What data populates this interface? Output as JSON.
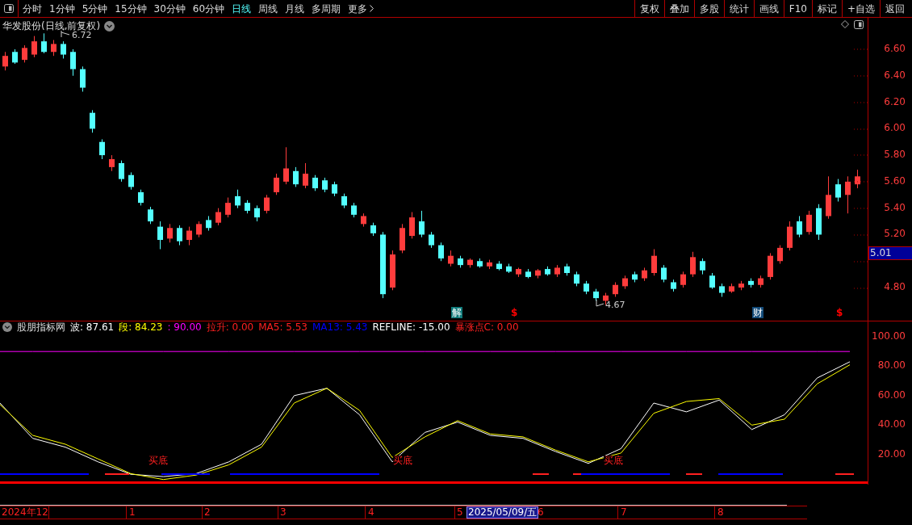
{
  "toolbar": {
    "periods": [
      {
        "label": "分时",
        "selected": false
      },
      {
        "label": "1分钟",
        "selected": false
      },
      {
        "label": "5分钟",
        "selected": false
      },
      {
        "label": "15分钟",
        "selected": false
      },
      {
        "label": "30分钟",
        "selected": false
      },
      {
        "label": "60分钟",
        "selected": false
      },
      {
        "label": "日线",
        "selected": true
      },
      {
        "label": "周线",
        "selected": false
      },
      {
        "label": "月线",
        "selected": false
      },
      {
        "label": "多周期",
        "selected": false
      }
    ],
    "more": "更多",
    "actions": [
      "复权",
      "叠加",
      "多股",
      "统计",
      "画线",
      "F10",
      "标记",
      "+自选",
      "返回"
    ]
  },
  "price_chart": {
    "title": "华发股份(日线,前复权)",
    "high_label": "6.72",
    "low_label": "4.67",
    "markers": [
      {
        "text": "解",
        "kind": "badge",
        "color": "#0f7a7a"
      },
      {
        "text": "$",
        "kind": "dollar",
        "color": "#ff0000"
      },
      {
        "text": "财",
        "kind": "badge",
        "color": "#124a78"
      },
      {
        "text": "$",
        "kind": "dollar",
        "color": "#ff0000"
      }
    ],
    "chart_data": {
      "type": "candlestick",
      "ylim": [
        4.55,
        6.838
      ],
      "yticks": [
        {
          "value": 6.6,
          "label": "6.60"
        },
        {
          "value": 6.4,
          "label": "6.40"
        },
        {
          "value": 6.2,
          "label": "6.20"
        },
        {
          "value": 6.0,
          "label": "6.00"
        },
        {
          "value": 5.8,
          "label": "5.80"
        },
        {
          "value": 5.6,
          "label": "5.60"
        },
        {
          "value": 5.4,
          "label": "5.40"
        },
        {
          "value": 5.2,
          "label": "5.20"
        },
        {
          "value": 4.8,
          "label": "4.80"
        }
      ],
      "categories": [
        null,
        null,
        null,
        null,
        null,
        null,
        null,
        null,
        null,
        null,
        null,
        null,
        null,
        null,
        null,
        null,
        null,
        null,
        null,
        null,
        null,
        null,
        null,
        null,
        null,
        null,
        null,
        null,
        null,
        null,
        null,
        null,
        null,
        null,
        null,
        null,
        null,
        null,
        null,
        null,
        null,
        null,
        null,
        null,
        null,
        null,
        null,
        null,
        null,
        null,
        null,
        null,
        null,
        null,
        null,
        null,
        null,
        null,
        null,
        null,
        null,
        null,
        null,
        null,
        null,
        null,
        null,
        null,
        null,
        null,
        null,
        null,
        null,
        null,
        null,
        null,
        null,
        null,
        null,
        null,
        null,
        null,
        null,
        null,
        null,
        null,
        null,
        null,
        null
      ],
      "ohlc": [
        [
          6.47,
          6.58,
          6.44,
          6.55
        ],
        [
          6.58,
          6.6,
          6.49,
          6.5
        ],
        [
          6.52,
          6.63,
          6.5,
          6.61
        ],
        [
          6.56,
          6.7,
          6.54,
          6.66
        ],
        [
          6.66,
          6.72,
          6.57,
          6.58
        ],
        [
          6.58,
          6.67,
          6.55,
          6.64
        ],
        [
          6.64,
          6.66,
          6.53,
          6.56
        ],
        [
          6.58,
          6.6,
          6.4,
          6.45
        ],
        [
          6.45,
          6.47,
          6.28,
          6.31
        ],
        [
          6.12,
          6.14,
          5.97,
          6.0
        ],
        [
          5.9,
          5.92,
          5.77,
          5.8
        ],
        [
          5.71,
          5.8,
          5.68,
          5.77
        ],
        [
          5.74,
          5.76,
          5.6,
          5.62
        ],
        [
          5.65,
          5.67,
          5.54,
          5.56
        ],
        [
          5.52,
          5.54,
          5.42,
          5.44
        ],
        [
          5.39,
          5.41,
          5.28,
          5.3
        ],
        [
          5.26,
          5.3,
          5.09,
          5.16
        ],
        [
          5.17,
          5.28,
          5.14,
          5.25
        ],
        [
          5.25,
          5.27,
          5.12,
          5.15
        ],
        [
          5.16,
          5.26,
          5.12,
          5.23
        ],
        [
          5.2,
          5.3,
          5.18,
          5.28
        ],
        [
          5.31,
          5.34,
          5.23,
          5.25
        ],
        [
          5.29,
          5.4,
          5.27,
          5.37
        ],
        [
          5.35,
          5.48,
          5.33,
          5.44
        ],
        [
          5.49,
          5.54,
          5.4,
          5.42
        ],
        [
          5.44,
          5.46,
          5.36,
          5.38
        ],
        [
          5.4,
          5.42,
          5.3,
          5.33
        ],
        [
          5.38,
          5.5,
          5.36,
          5.48
        ],
        [
          5.52,
          5.66,
          5.5,
          5.63
        ],
        [
          5.6,
          5.86,
          5.58,
          5.7
        ],
        [
          5.68,
          5.71,
          5.56,
          5.58
        ],
        [
          5.57,
          5.74,
          5.55,
          5.66
        ],
        [
          5.63,
          5.65,
          5.53,
          5.55
        ],
        [
          5.61,
          5.63,
          5.52,
          5.54
        ],
        [
          5.58,
          5.6,
          5.49,
          5.51
        ],
        [
          5.49,
          5.51,
          5.4,
          5.42
        ],
        [
          5.42,
          5.44,
          5.33,
          5.35
        ],
        [
          5.28,
          5.36,
          5.26,
          5.34
        ],
        [
          5.27,
          5.29,
          5.19,
          5.21
        ],
        [
          5.2,
          5.22,
          4.72,
          4.75
        ],
        [
          4.8,
          5.08,
          4.78,
          5.05
        ],
        [
          5.08,
          5.28,
          5.06,
          5.25
        ],
        [
          5.19,
          5.37,
          5.17,
          5.33
        ],
        [
          5.3,
          5.38,
          5.18,
          5.2
        ],
        [
          5.2,
          5.22,
          5.1,
          5.12
        ],
        [
          5.12,
          5.14,
          5.0,
          5.02
        ],
        [
          4.98,
          5.08,
          4.96,
          5.04
        ],
        [
          5.02,
          5.04,
          4.95,
          4.97
        ],
        [
          4.97,
          5.02,
          4.95,
          5.01
        ],
        [
          5.0,
          5.02,
          4.95,
          4.96
        ],
        [
          4.96,
          5.01,
          4.94,
          4.99
        ],
        [
          4.98,
          5.0,
          4.93,
          4.94
        ],
        [
          4.96,
          4.98,
          4.91,
          4.92
        ],
        [
          4.9,
          4.95,
          4.88,
          4.94
        ],
        [
          4.92,
          4.94,
          4.87,
          4.88
        ],
        [
          4.89,
          4.94,
          4.87,
          4.93
        ],
        [
          4.94,
          4.96,
          4.89,
          4.9
        ],
        [
          4.9,
          4.97,
          4.88,
          4.95
        ],
        [
          4.96,
          4.98,
          4.89,
          4.91
        ],
        [
          4.9,
          4.92,
          4.81,
          4.83
        ],
        [
          4.83,
          4.85,
          4.75,
          4.77
        ],
        [
          4.77,
          4.79,
          4.7,
          4.72
        ],
        [
          4.7,
          4.76,
          4.67,
          4.74
        ],
        [
          4.75,
          4.84,
          4.73,
          4.82
        ],
        [
          4.81,
          4.89,
          4.79,
          4.87
        ],
        [
          4.9,
          4.92,
          4.84,
          4.86
        ],
        [
          4.87,
          4.95,
          4.85,
          4.93
        ],
        [
          4.91,
          5.09,
          4.89,
          5.04
        ],
        [
          4.95,
          4.97,
          4.84,
          4.86
        ],
        [
          4.84,
          4.86,
          4.77,
          4.79
        ],
        [
          4.82,
          4.92,
          4.8,
          4.9
        ],
        [
          4.9,
          5.07,
          4.88,
          5.03
        ],
        [
          5.0,
          5.02,
          4.9,
          4.93
        ],
        [
          4.89,
          4.91,
          4.79,
          4.8
        ],
        [
          4.81,
          4.83,
          4.73,
          4.76
        ],
        [
          4.77,
          4.83,
          4.76,
          4.81
        ],
        [
          4.8,
          4.85,
          4.78,
          4.83
        ],
        [
          4.85,
          4.87,
          4.8,
          4.82
        ],
        [
          4.82,
          4.89,
          4.8,
          4.87
        ],
        [
          4.88,
          5.06,
          4.86,
          5.04
        ],
        [
          5.0,
          5.12,
          4.98,
          5.1
        ],
        [
          5.1,
          5.3,
          5.08,
          5.26
        ],
        [
          5.3,
          5.34,
          5.18,
          5.2
        ],
        [
          5.22,
          5.38,
          5.2,
          5.35
        ],
        [
          5.4,
          5.43,
          5.16,
          5.2
        ],
        [
          5.34,
          5.64,
          5.32,
          5.5
        ],
        [
          5.58,
          5.62,
          5.45,
          5.48
        ],
        [
          5.5,
          5.64,
          5.36,
          5.6
        ],
        [
          5.58,
          5.69,
          5.55,
          5.64
        ]
      ]
    },
    "current_price": "5.01"
  },
  "indicator": {
    "name": "股朋指标网",
    "legend": [
      {
        "kind": "text",
        "label": "波: 87.61",
        "color": "#ffffff"
      },
      {
        "kind": "text",
        "label": "段: 84.23",
        "color": "#ffff00"
      },
      {
        "kind": "text",
        "label": ": 90.00",
        "color": "#ff00ff"
      },
      {
        "kind": "text",
        "label": "拉升: 0.00",
        "color": "#ff2020"
      },
      {
        "kind": "text",
        "label": "MA5: 5.53",
        "color": "#ff2020"
      },
      {
        "kind": "text",
        "label": "MA13: 5.43",
        "color": "#0000ff"
      },
      {
        "kind": "text",
        "label": "REFLINE: -15.00",
        "color": "#ffffff"
      },
      {
        "kind": "text",
        "label": "暴涨点C: 0.00",
        "color": "#ff2020"
      }
    ],
    "chart_data": {
      "type": "line",
      "categories": [
        null,
        null,
        null,
        null,
        null,
        null,
        null,
        null,
        null,
        null,
        null,
        null,
        null,
        null,
        null,
        null,
        null,
        null,
        null,
        null,
        null,
        null,
        null,
        null,
        null,
        null,
        null
      ],
      "ylim": [
        -1,
        110.4
      ],
      "yticks": [
        {
          "value": 100,
          "label": "100.00"
        },
        {
          "value": 80,
          "label": "80.00"
        },
        {
          "value": 60,
          "label": "60.00"
        },
        {
          "value": 40,
          "label": "40.00"
        },
        {
          "value": 20,
          "label": "20.00"
        }
      ],
      "series": [
        {
          "color": "#ffffff",
          "values": [
            55,
            31,
            25,
            15,
            6.6,
            5,
            7,
            15,
            27,
            60,
            65,
            47,
            15,
            35,
            42,
            33,
            31,
            22,
            14,
            24,
            55,
            49,
            57,
            37,
            47,
            72,
            83
          ]
        },
        {
          "color": "#ffff00",
          "values": [
            54,
            33,
            27,
            17,
            7,
            3,
            6,
            13,
            25,
            55,
            65,
            50,
            18,
            32,
            43,
            34,
            32,
            23,
            15,
            21,
            48,
            56,
            58,
            40,
            44,
            68,
            81
          ]
        },
        {
          "color": "#ff00ff",
          "values": [
            90,
            90,
            90,
            90,
            90,
            90,
            90,
            90,
            90,
            90,
            90,
            90,
            90,
            90,
            90,
            90,
            90,
            90,
            90,
            90,
            90,
            90,
            90,
            90,
            90,
            90,
            90
          ]
        }
      ]
    },
    "signals": [
      "买底",
      "买底",
      "买底"
    ]
  },
  "date_axis": {
    "labels": [
      "2024年12",
      "1",
      "2",
      "3",
      "4",
      "5",
      "6",
      "7",
      "8"
    ],
    "cursor_date": "2025/05/09/五"
  }
}
